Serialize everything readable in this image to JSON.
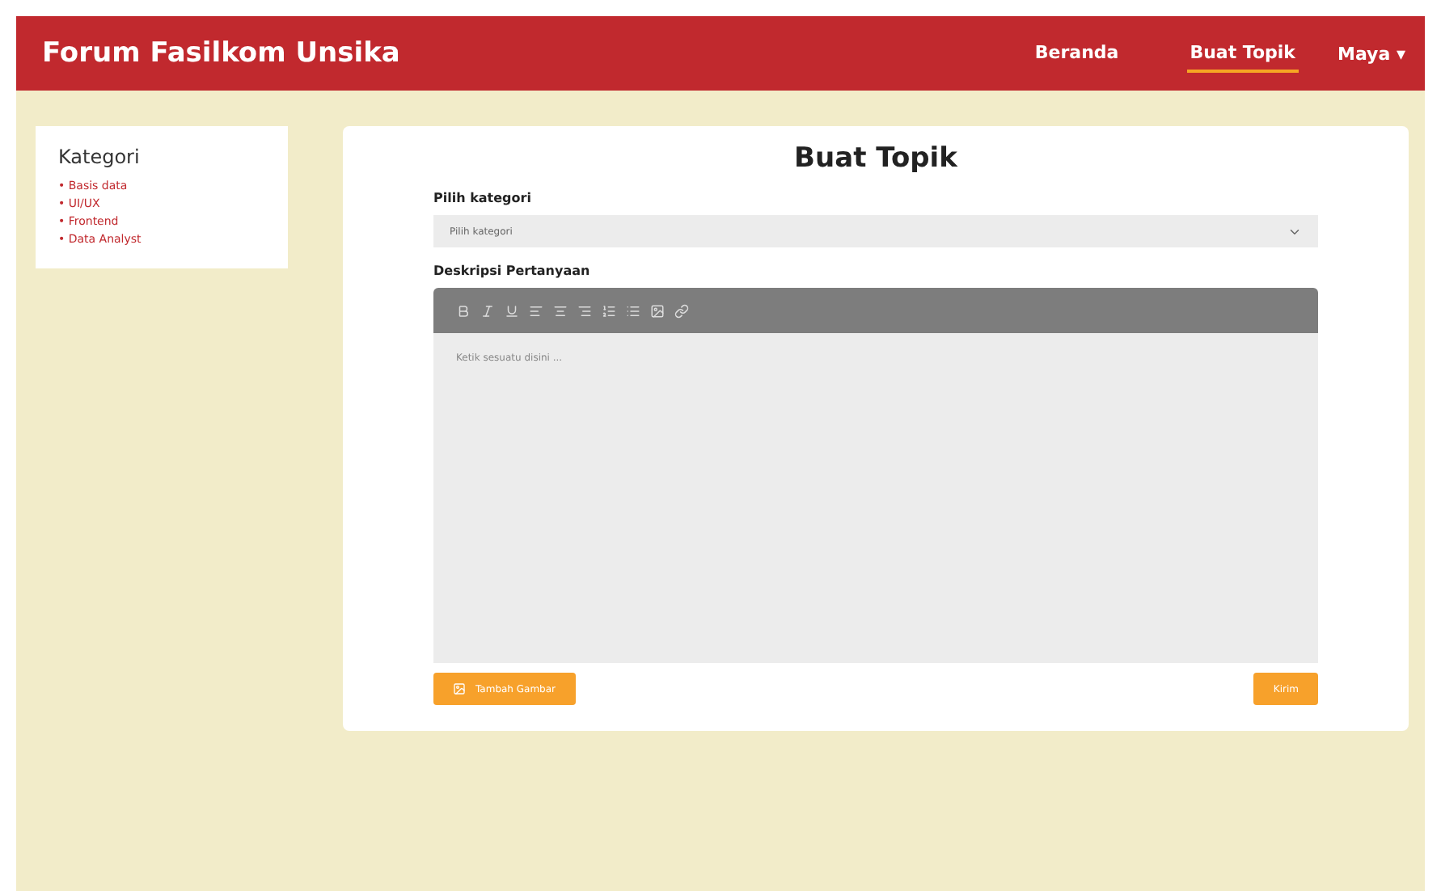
{
  "navbar": {
    "brand": "Forum Fasilkom Unsika",
    "links": [
      {
        "label": "Beranda",
        "selected": false
      },
      {
        "label": "Buat Topik",
        "selected": true
      }
    ],
    "user": {
      "label": "Maya",
      "caret": "▾"
    }
  },
  "sidebar": {
    "title": "Kategori",
    "items": [
      "• Basis data",
      "• UI/UX",
      "• Frontend",
      "• Data Analyst"
    ]
  },
  "form": {
    "title": "Buat Topik",
    "category_label": "Pilih kategori",
    "category_placeholder": "Pilih kategori",
    "description_label": "Deskripsi Pertanyaan",
    "editor_placeholder": "Ketik sesuatu disini ...",
    "toolbar": [
      {
        "kind": "bold"
      },
      {
        "kind": "italic"
      },
      {
        "kind": "underline"
      },
      {
        "kind": "align-left"
      },
      {
        "kind": "align-center"
      },
      {
        "kind": "align-right"
      },
      {
        "kind": "list-ordered"
      },
      {
        "kind": "list-bullet"
      },
      {
        "kind": "image"
      },
      {
        "kind": "link"
      }
    ],
    "add_image_button": "Tambah Gambar",
    "submit_button": "Kirim"
  }
}
